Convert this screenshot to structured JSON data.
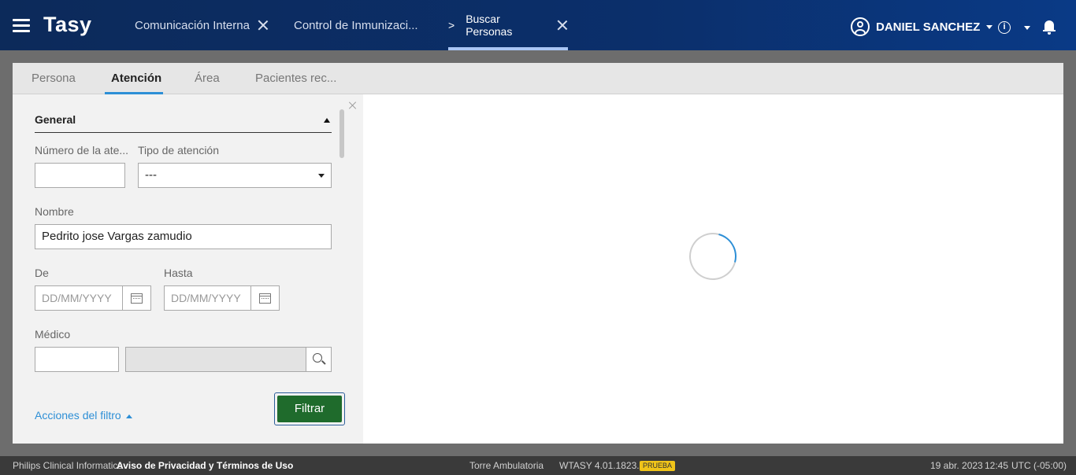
{
  "header": {
    "app_title": "Tasy",
    "tabs": [
      {
        "label": "Comunicación Interna"
      },
      {
        "label": "Control de Inmunizaci..."
      },
      {
        "label": "Buscar Personas"
      }
    ],
    "user_name": "DANIEL SANCHEZ",
    "info_glyph": "i"
  },
  "subtabs": [
    {
      "label": "Persona"
    },
    {
      "label": "Atención"
    },
    {
      "label": "Área"
    },
    {
      "label": "Pacientes rec..."
    }
  ],
  "filters": {
    "section_title": "General",
    "numero_label": "Número de la ate...",
    "numero_value": "",
    "tipo_label": "Tipo de atención",
    "tipo_value": "---",
    "nombre_label": "Nombre",
    "nombre_value": "Pedrito jose Vargas zamudio",
    "de_label": "De",
    "de_placeholder": "DD/MM/YYYY",
    "hasta_label": "Hasta",
    "hasta_placeholder": "DD/MM/YYYY",
    "medico_label": "Médico",
    "medico_code": "",
    "medico_name": "",
    "actions_label": "Acciones del filtro",
    "filter_button": "Filtrar"
  },
  "footer": {
    "company": "Philips Clinical Informatics",
    "privacy": "Aviso de Privacidad y Términos de Uso",
    "location": "Torre Ambulatoria",
    "version": "WTASY 4.01.1823.14",
    "env_badge": "PRUEBA",
    "date": "19 abr. 2023",
    "time": "12:45",
    "timezone": "UTC (-05:00)"
  },
  "colors": {
    "header_bg": "#0b2f6b",
    "accent": "#2d8fd6",
    "filter_button": "#1f6b2c",
    "badge": "#f0c419"
  }
}
